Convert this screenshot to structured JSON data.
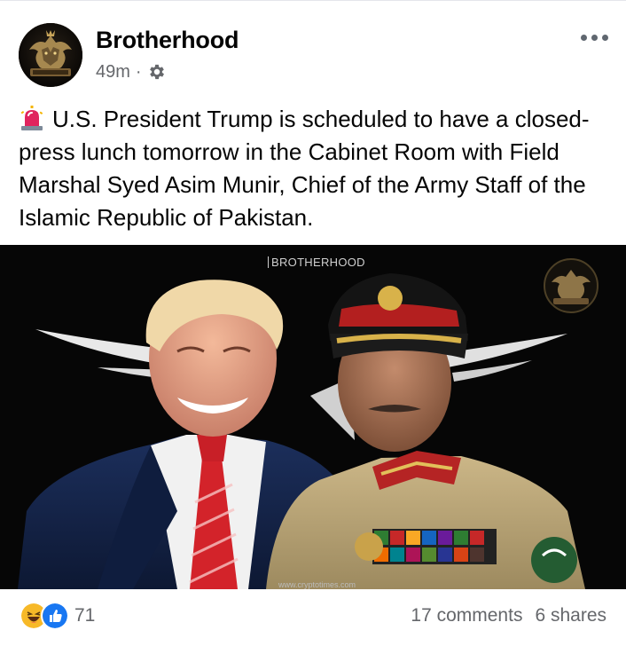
{
  "post": {
    "page_name": "Brotherhood",
    "time": "49m",
    "separator": "·",
    "privacy_icon": "gear-icon",
    "text": "U.S. President Trump is scheduled to have a closed-press lunch tomorrow in the Cabinet Room with Field Marshal Syed Asim Munir, Chief of the Army Staff of the Islamic Republic of Pakistan.",
    "lead_emoji": "police-siren-icon"
  },
  "image": {
    "watermark_top": "BROTHERHOOD",
    "watermark_bottom": "www.cryptotimes.com",
    "description_icon": "photo"
  },
  "footer": {
    "reaction_icons": [
      "haha-reaction-icon",
      "like-reaction-icon"
    ],
    "reaction_count": "71",
    "comments": "17 comments",
    "shares": "6 shares"
  },
  "colors": {
    "meta_text": "#65676b",
    "like_blue": "#1877f2",
    "haha_yellow": "#f7b928",
    "siren_red": "#e0245e"
  }
}
